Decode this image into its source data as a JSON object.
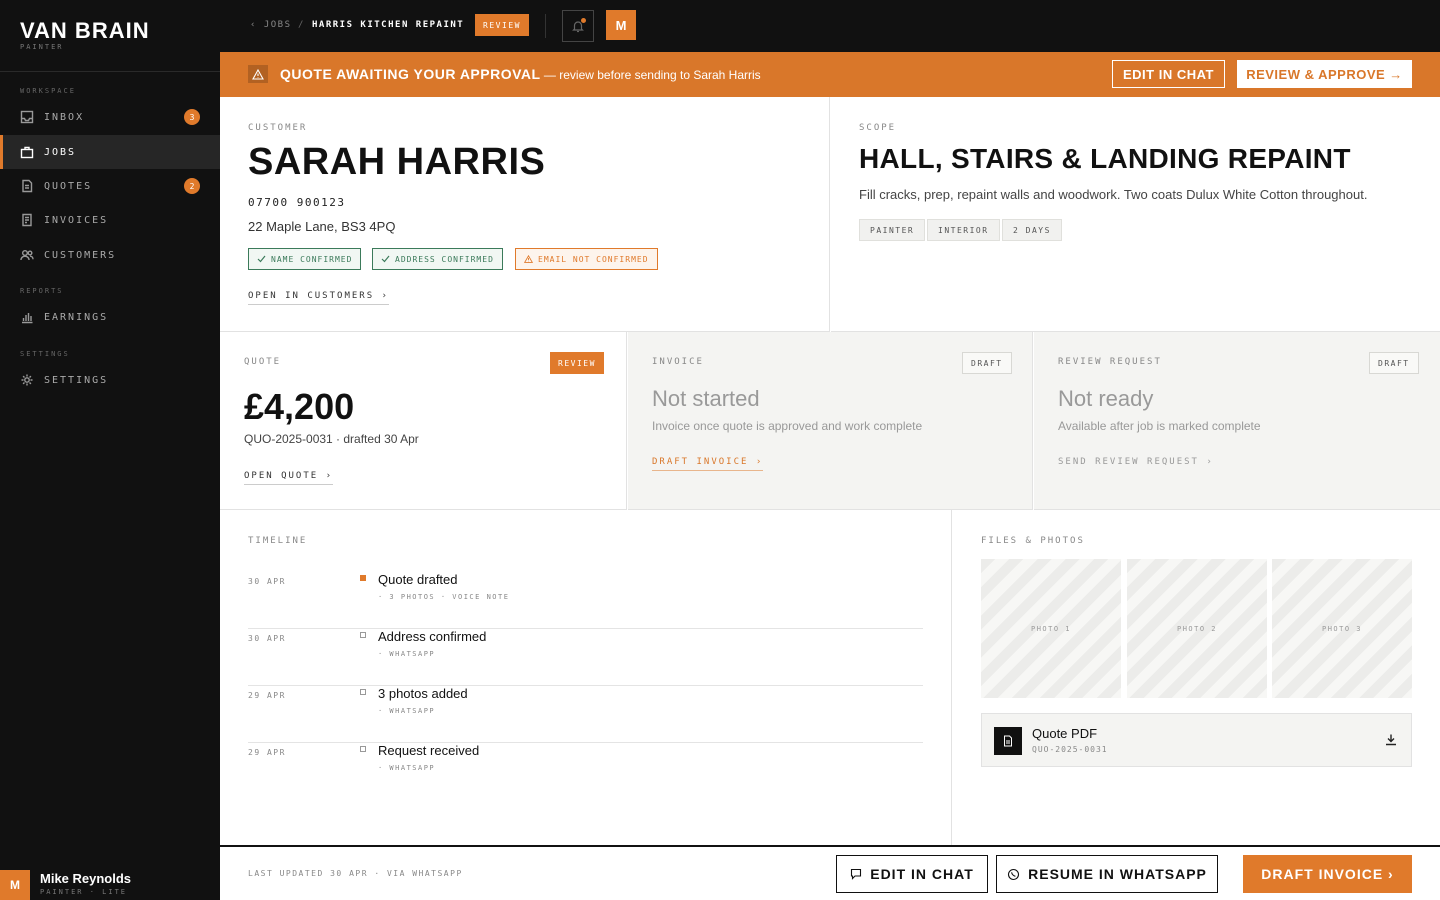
{
  "brand": {
    "name": "VAN BRAIN",
    "sub": "PAINTER"
  },
  "sidebar": {
    "sections": {
      "workspace": "WORKSPACE",
      "reports": "REPORTS",
      "settings": "SETTINGS"
    },
    "items": [
      {
        "label": "INBOX",
        "badge": "3",
        "icon": "inbox-icon"
      },
      {
        "label": "JOBS",
        "icon": "briefcase-icon",
        "active": true
      },
      {
        "label": "QUOTES",
        "badge": "2",
        "icon": "document-icon"
      },
      {
        "label": "INVOICES",
        "icon": "receipt-icon"
      },
      {
        "label": "CUSTOMERS",
        "icon": "users-icon"
      },
      {
        "label": "EARNINGS",
        "icon": "bar-chart-icon"
      },
      {
        "label": "SETTINGS",
        "icon": "gear-icon"
      }
    ],
    "user": {
      "initial": "M",
      "name": "Mike Reynolds",
      "role": "PAINTER · LITE"
    }
  },
  "topbar": {
    "back_label": "‹ JOBS",
    "separator": "/",
    "job_title": "HARRIS KITCHEN REPAINT",
    "status": "REVIEW",
    "avatar": "M"
  },
  "banner": {
    "title": "QUOTE AWAITING YOUR APPROVAL",
    "subtitle": " — review before sending to Sarah Harris",
    "edit_label": "EDIT IN CHAT",
    "approve_label": "REVIEW & APPROVE →"
  },
  "customer": {
    "caption": "CUSTOMER",
    "name": "SARAH HARRIS",
    "phone": "07700 900123",
    "address": "22 Maple Lane, BS3 4PQ",
    "chips": [
      {
        "label": "NAME CONFIRMED",
        "status": "ok"
      },
      {
        "label": "ADDRESS CONFIRMED",
        "status": "ok"
      },
      {
        "label": "EMAIL NOT CONFIRMED",
        "status": "warn"
      }
    ],
    "link": "OPEN IN CUSTOMERS ›"
  },
  "scope": {
    "caption": "SCOPE",
    "title": "HALL, STAIRS & LANDING REPAINT",
    "description": "Fill cracks, prep, repaint walls and woodwork. Two coats Dulux White Cotton throughout.",
    "tags": [
      "PAINTER",
      "INTERIOR",
      "2 DAYS"
    ]
  },
  "quote": {
    "caption": "QUOTE",
    "status": "REVIEW",
    "amount": "£4,200",
    "meta": "QUO-2025-0031 · drafted 30 Apr",
    "link": "OPEN QUOTE ›"
  },
  "invoice": {
    "caption": "INVOICE",
    "status": "DRAFT",
    "headline": "Not started",
    "note": "Invoice once quote is approved and work complete",
    "link": "DRAFT INVOICE ›"
  },
  "review_request": {
    "caption": "REVIEW REQUEST",
    "status": "DRAFT",
    "headline": "Not ready",
    "note": "Available after job is marked complete",
    "link": "SEND REVIEW REQUEST ›"
  },
  "timeline": {
    "caption": "TIMELINE",
    "events": [
      {
        "date": "30 APR",
        "title": "Quote drafted",
        "sub": "· 3 PHOTOS · VOICE NOTE",
        "highlight": true
      },
      {
        "date": "30 APR",
        "title": "Address confirmed",
        "sub": "· WHATSAPP",
        "highlight": false
      },
      {
        "date": "29 APR",
        "title": "3 photos added",
        "sub": "· WHATSAPP",
        "highlight": false
      },
      {
        "date": "29 APR",
        "title": "Request received",
        "sub": "· WHATSAPP",
        "highlight": false
      }
    ]
  },
  "files": {
    "caption": "FILES & PHOTOS",
    "photos": [
      "PHOTO 1",
      "PHOTO 2",
      "PHOTO 3"
    ],
    "pdf": {
      "title": "Quote PDF",
      "ref": "QUO-2025-0031"
    }
  },
  "footer": {
    "updated": "LAST UPDATED 30 APR · VIA WHATSAPP",
    "edit_label": "EDIT IN CHAT",
    "whatsapp_label": "RESUME IN WHATSAPP",
    "primary_label": "DRAFT INVOICE ›"
  },
  "colors": {
    "accent": "#e07a2b",
    "banner": "#d9772a",
    "ok": "#3b7a5a",
    "dark": "#111111"
  }
}
